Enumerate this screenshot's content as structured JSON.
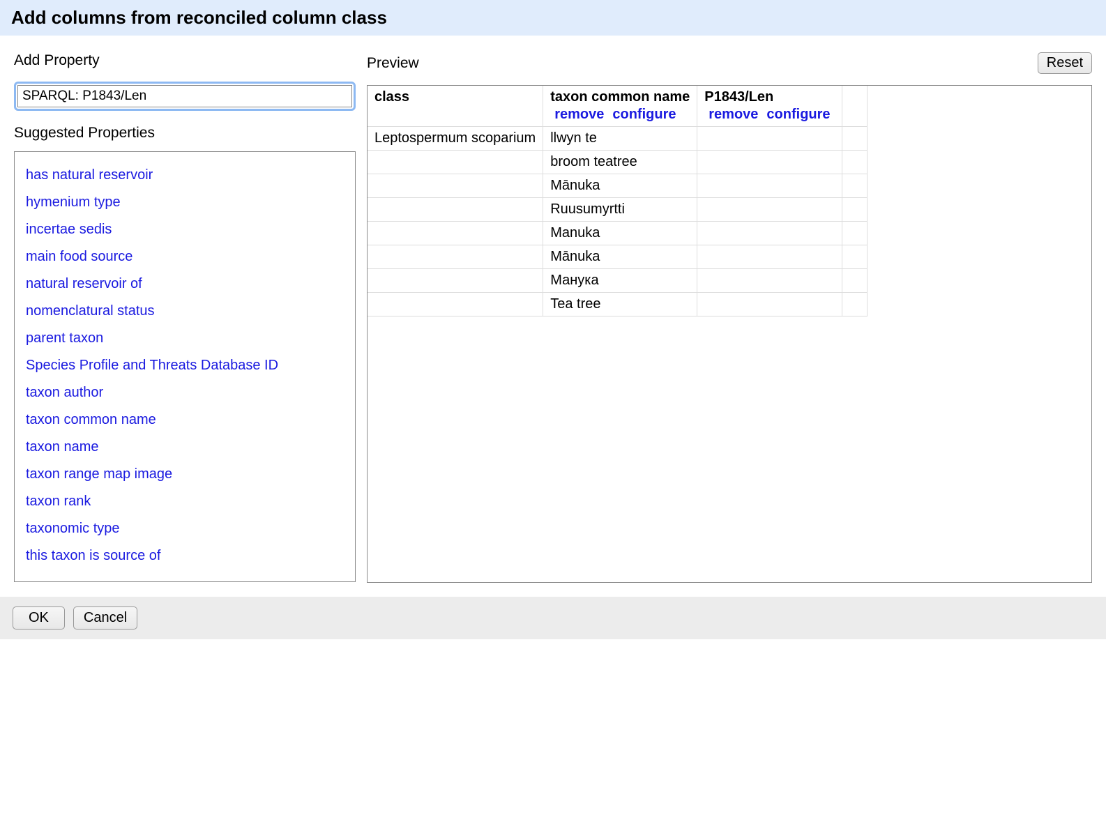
{
  "header": {
    "title": "Add columns from reconciled column class"
  },
  "add_property": {
    "title": "Add Property",
    "input_value": "SPARQL: P1843/Len"
  },
  "suggested": {
    "title": "Suggested Properties",
    "items": [
      "has natural reservoir",
      "hymenium type",
      "incertae sedis",
      "main food source",
      "natural reservoir of",
      "nomenclatural status",
      "parent taxon",
      "Species Profile and Threats Database ID",
      "taxon author",
      "taxon common name",
      "taxon name",
      "taxon range map image",
      "taxon rank",
      "taxonomic type",
      "this taxon is source of"
    ]
  },
  "preview": {
    "title": "Preview",
    "reset_label": "Reset",
    "action_remove": "remove",
    "action_configure": "configure",
    "columns": [
      {
        "label": "class",
        "actions": false
      },
      {
        "label": "taxon common name",
        "actions": true
      },
      {
        "label": "P1843/Len",
        "actions": true
      }
    ],
    "rows": [
      [
        "Leptospermum scoparium",
        "llwyn te",
        ""
      ],
      [
        "",
        "broom teatree",
        ""
      ],
      [
        "",
        "Mānuka",
        ""
      ],
      [
        "",
        "Ruusumyrtti",
        ""
      ],
      [
        "",
        "Manuka",
        ""
      ],
      [
        "",
        "Mānuka",
        ""
      ],
      [
        "",
        "Манука",
        ""
      ],
      [
        "",
        "Tea tree",
        ""
      ]
    ]
  },
  "footer": {
    "ok_label": "OK",
    "cancel_label": "Cancel"
  }
}
